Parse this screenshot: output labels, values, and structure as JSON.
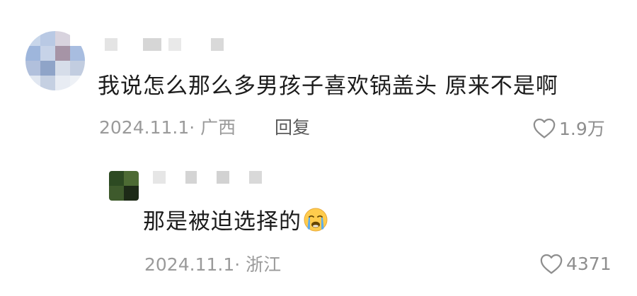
{
  "comment": {
    "text": "我说怎么那么多男孩子喜欢锅盖头 原来不是啊",
    "date": "2024.11.1",
    "location": "广西",
    "reply_label": "回复",
    "like_count": "1.9万"
  },
  "reply": {
    "text": "那是被迫选择的",
    "emoji": "loudly-crying-face",
    "date": "2024.11.1",
    "location": "浙江",
    "like_count": "4371"
  },
  "colors": {
    "text_primary": "#1c1c1c",
    "text_meta": "#9a9a9a",
    "reply_button": "#5a5a5a",
    "like_icon": "#8e8e8e"
  }
}
